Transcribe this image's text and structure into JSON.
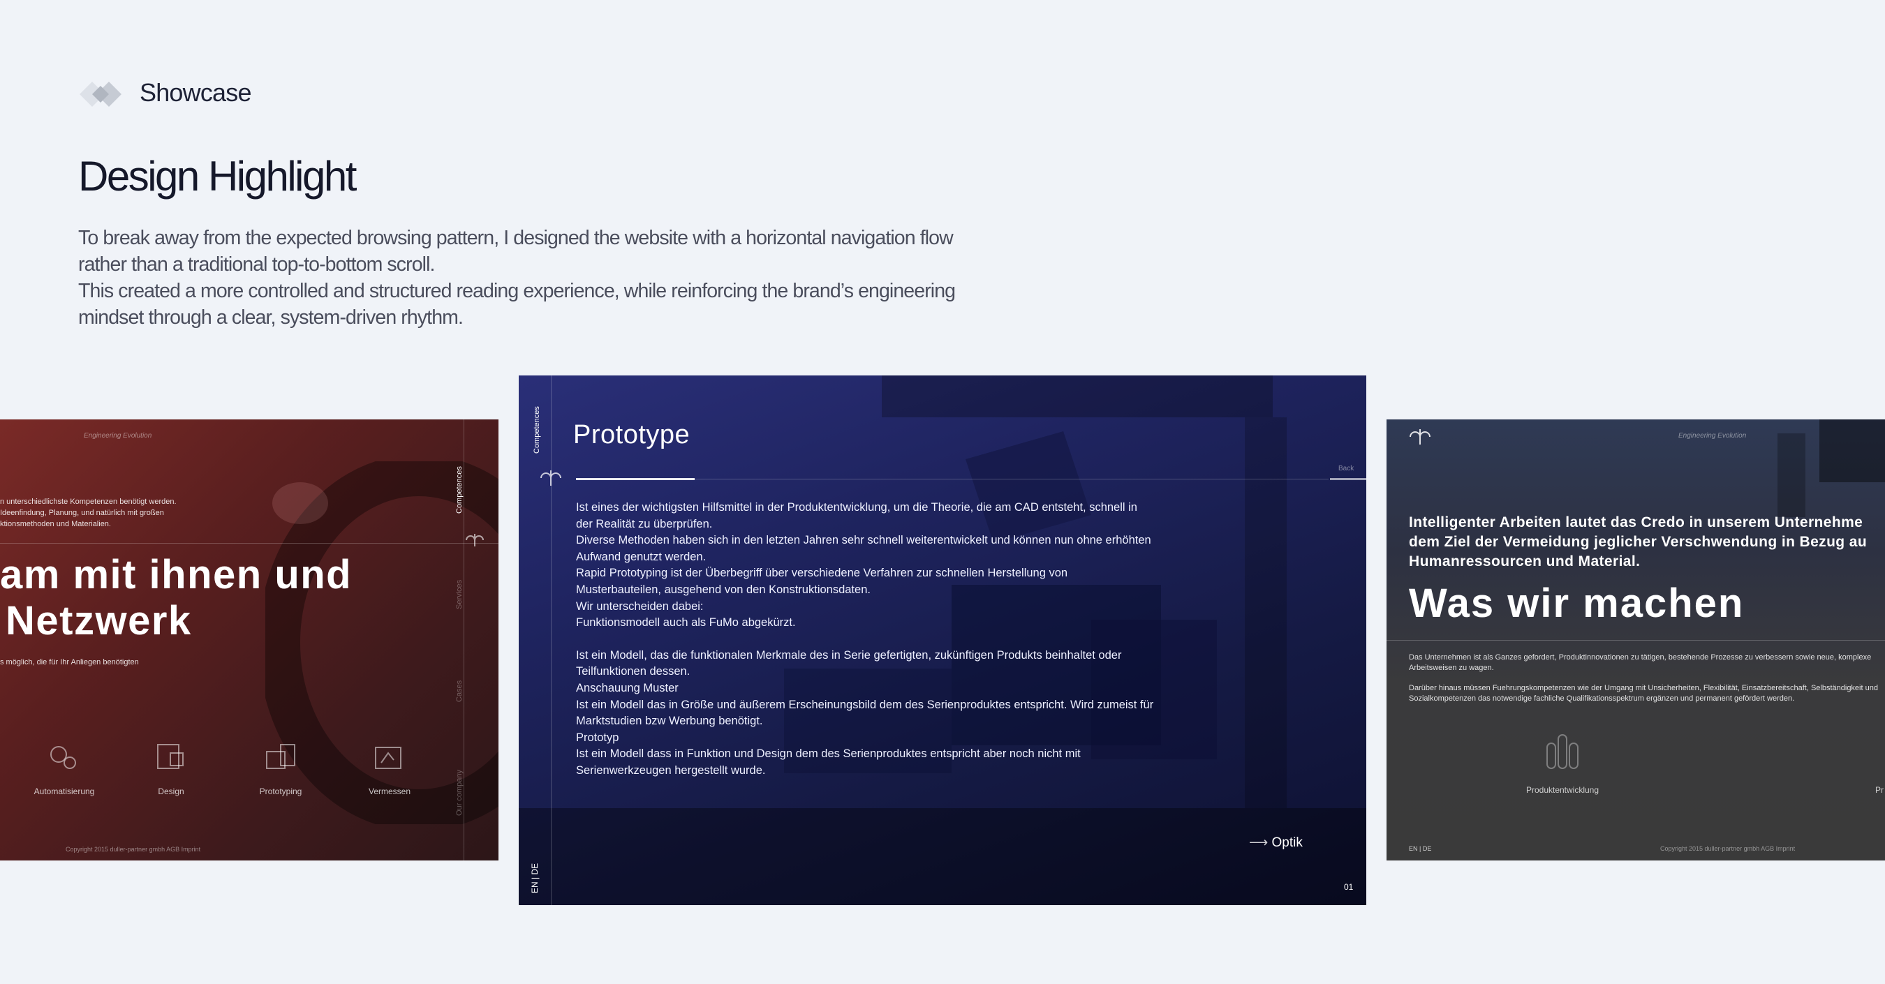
{
  "header": {
    "logo_icon": "diamond-logo-icon",
    "section_label": "Showcase",
    "title": "Design Highlight",
    "description": [
      "To break away from the expected browsing pattern, I designed the website with a horizontal navigation flow rather than a traditional top-to-bottom scroll.",
      "This created a more controlled and structured reading experience, while reinforcing the brand’s engineering mindset through a clear, system-driven rhythm."
    ]
  },
  "card_left": {
    "tagline": "Engineering Evolution",
    "intro_lines": [
      "n unterschiedlichste Kompetenzen benötigt werden.",
      "Ideenfindung, Planung, und natürlich mit großen",
      "ktionsmethoden und Materialien."
    ],
    "headline_line1": "am mit ihnen und",
    "headline_line2": "Netzwerk",
    "sub_text": "s möglich, die für Ihr Anliegen benötigten",
    "nav_vertical": [
      "Competences",
      "Services",
      "Cases",
      "Our company"
    ],
    "icons": [
      {
        "icon": "gears-icon",
        "label": "Automatisierung"
      },
      {
        "icon": "blueprint-icon",
        "label": "Design"
      },
      {
        "icon": "prototype-icon",
        "label": "Prototyping"
      },
      {
        "icon": "measure-icon",
        "label": "Vermessen"
      }
    ],
    "footer": "Copyright 2015 duller-partner gmbh   AGB   Imprint"
  },
  "card_center": {
    "vertical_label": "Competences",
    "title": "Prototype",
    "back_label": "Back",
    "lang": "EN | DE",
    "page_number": "01",
    "next_label": "Optik",
    "paragraphs": [
      "Ist eines der wichtigsten Hilfsmittel in der Produktentwicklung, um die Theorie, die am CAD entsteht, schnell in der Realität zu überprüfen.",
      "Diverse Methoden haben sich in den letzten Jahren sehr schnell weiterentwickelt und können  nun ohne erhöhten Aufwand genutzt werden.",
      "Rapid Prototyping ist der Überbegriff über verschiedene Verfahren zur schnellen Herstellung von Musterbauteilen, ausgehend von den Konstruktionsdaten.",
      "Wir unterscheiden dabei:",
      "Funktionsmodell auch als FuMo abgekürzt.",
      "",
      "Ist ein Modell, das die funktionalen Merkmale des in Serie gefertigten, zukünftigen Produkts beinhaltet oder Teilfunktionen dessen.",
      "Anschauung Muster",
      "Ist ein Modell das in Größe und äußerem Erscheinungsbild dem des Serienproduktes entspricht. Wird zumeist für Marktstudien bzw Werbung benötigt.",
      "Prototyp",
      "Ist ein Modell dass in Funktion und Design dem des Serienproduktes entspricht aber noch nicht mit Serienwerkzeugen hergestellt wurde."
    ]
  },
  "card_right": {
    "tagline": "Engineering Evolution",
    "lead": "Intelligenter Arbeiten lautet das Credo in unserem Unternehme dem Ziel der Vermeidung jeglicher Verschwendung in Bezug au Humanressourcen und Material.",
    "headline": "Was wir machen",
    "para1": "Das Unternehmen ist als Ganzes gefordert, Produktinnovationen zu tätigen, bestehende Prozesse zu verbessern sowie neue, komplexe Arbeitsweisen zu wagen.",
    "para2": "Darüber hinaus müssen Fuehrungskompetenzen wie der Umgang mit Unsicherheiten, Flexibilität, Einsatzbereitschaft, Selbständigkeit und Sozialkompetenzen das notwendige fachliche Qualifikationsspektrum ergänzen und permanent gefördert werden.",
    "icon_label": "Produktentwicklung",
    "icon_label_cut": "Pr",
    "lang": "EN | DE",
    "footer": "Copyright 2015 duller-partner gmbh   AGB   Imprint"
  }
}
